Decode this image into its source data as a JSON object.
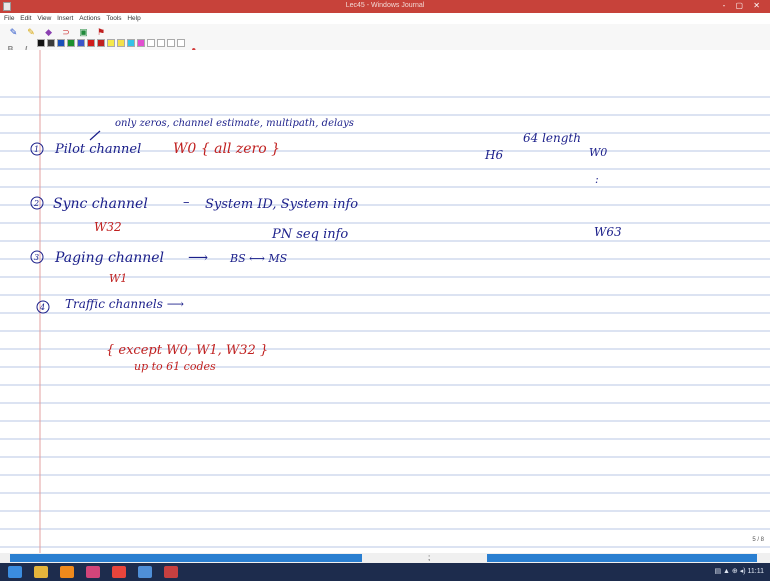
{
  "window": {
    "title": "Lec45 - Windows Journal",
    "controls": "- ▢ ✕"
  },
  "menu": [
    "File",
    "Edit",
    "View",
    "Insert",
    "Actions",
    "Tools",
    "Help"
  ],
  "toolbar": {
    "format_bold": "B",
    "format_italic": "I",
    "swatches": [
      "#111111",
      "#3a3a3a",
      "#1a4fb8",
      "#1b8f2c",
      "#3b54c9",
      "#d11c1c",
      "#c0201f",
      "#f5e94a",
      "#f3e04a",
      "#34c3e8",
      "#e24fd0",
      "#ffffff",
      "#ffffff",
      "#ffffff",
      "#ffffff"
    ]
  },
  "note": {
    "annotation": "only zeros, channel estimate, multipath, delays",
    "item1_num": "1",
    "item1_label": "Pilot channel",
    "item1_code": "W0 { all zero }",
    "item2_num": "2",
    "item2_label": "Sync channel",
    "item2_dash": "–",
    "item2_info": "System ID,  System info",
    "item2_code": "W32",
    "item2_pn": "PN seq info",
    "item3_num": "3",
    "item3_label": "Paging channel",
    "item3_code": "W1",
    "item3_arrow": "⟶",
    "item3_bs_ms": "BS ⟷ MS",
    "item4_num": "4",
    "item4_label": "Traffic channels ⟶",
    "item4_except": "{ except  W0, W1, W32 }",
    "item4_upto": "up to 61 codes",
    "right_length": "64 length",
    "right_h": "H6",
    "right_w0": "W0",
    "right_dots": ":",
    "right_w63": "W63"
  },
  "page_number": "5 / 8",
  "scroll_mid": ";",
  "tray": "▤  ▲ ⊕ ◂)  11:11"
}
